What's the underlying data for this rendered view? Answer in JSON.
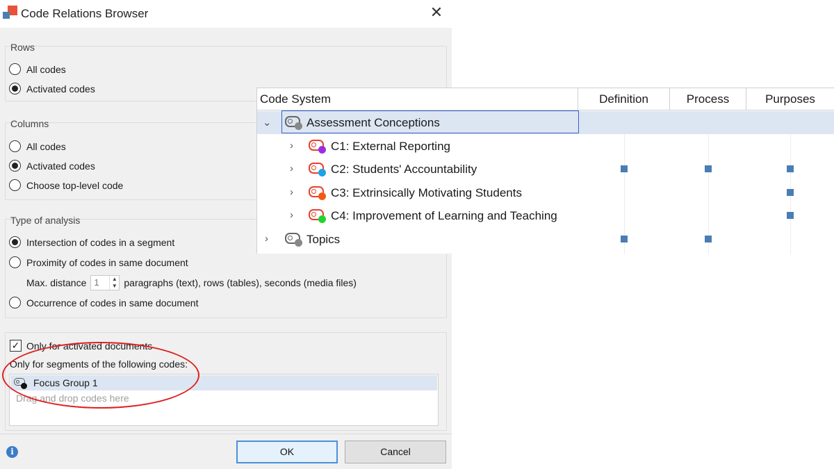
{
  "dialog": {
    "title": "Code Relations Browser",
    "rows": {
      "label": "Rows",
      "options": [
        "All codes",
        "Activated codes"
      ],
      "selected": "Activated codes"
    },
    "columns": {
      "label": "Columns",
      "options": [
        "All codes",
        "Activated codes",
        "Choose top-level code"
      ],
      "selected": "Activated codes"
    },
    "analysis": {
      "label": "Type of analysis",
      "options": [
        "Intersection of codes in a segment",
        "Proximity of codes in same document",
        "Occurrence of codes in same document"
      ],
      "selected": "Intersection of codes in a segment",
      "max_distance_label": "Max. distance",
      "max_distance_value": "1",
      "max_distance_unit": "paragraphs (text), rows (tables), seconds (media files)"
    },
    "only_activated_docs": {
      "label": "Only for activated documents",
      "checked": true
    },
    "segments_label": "Only for segments of the following codes:",
    "codes_list": [
      {
        "label": "Focus Group 1",
        "icon": "code-icon-black"
      }
    ],
    "codes_placeholder": "Drag and drop codes here",
    "ok_label": "OK",
    "cancel_label": "Cancel",
    "info_icon": "info-icon"
  },
  "matrix": {
    "header": "Code System",
    "columns": [
      "Definition",
      "Process",
      "Purposes"
    ],
    "rows": [
      {
        "label": "Assessment Conceptions",
        "expanded": true,
        "selected": true,
        "icon_color": "#888888",
        "cells": [
          false,
          false,
          false
        ]
      },
      {
        "label": "C1: External Reporting",
        "icon_color": "#9b2de0",
        "cells": [
          false,
          false,
          false
        ]
      },
      {
        "label": "C2: Students' Accountability",
        "icon_color": "#1ea1e8",
        "cells": [
          true,
          true,
          true
        ]
      },
      {
        "label": "C3: Extrinsically Motivating Students",
        "icon_color": "#f25a13",
        "cells": [
          false,
          false,
          true
        ]
      },
      {
        "label": "C4: Improvement of Learning and Teaching",
        "icon_color": "#22d42a",
        "cells": [
          false,
          false,
          true
        ]
      },
      {
        "label": "Topics",
        "icon_color": "#888888",
        "cells": [
          true,
          true,
          false
        ]
      }
    ],
    "mark_color": "#4a7db3"
  }
}
